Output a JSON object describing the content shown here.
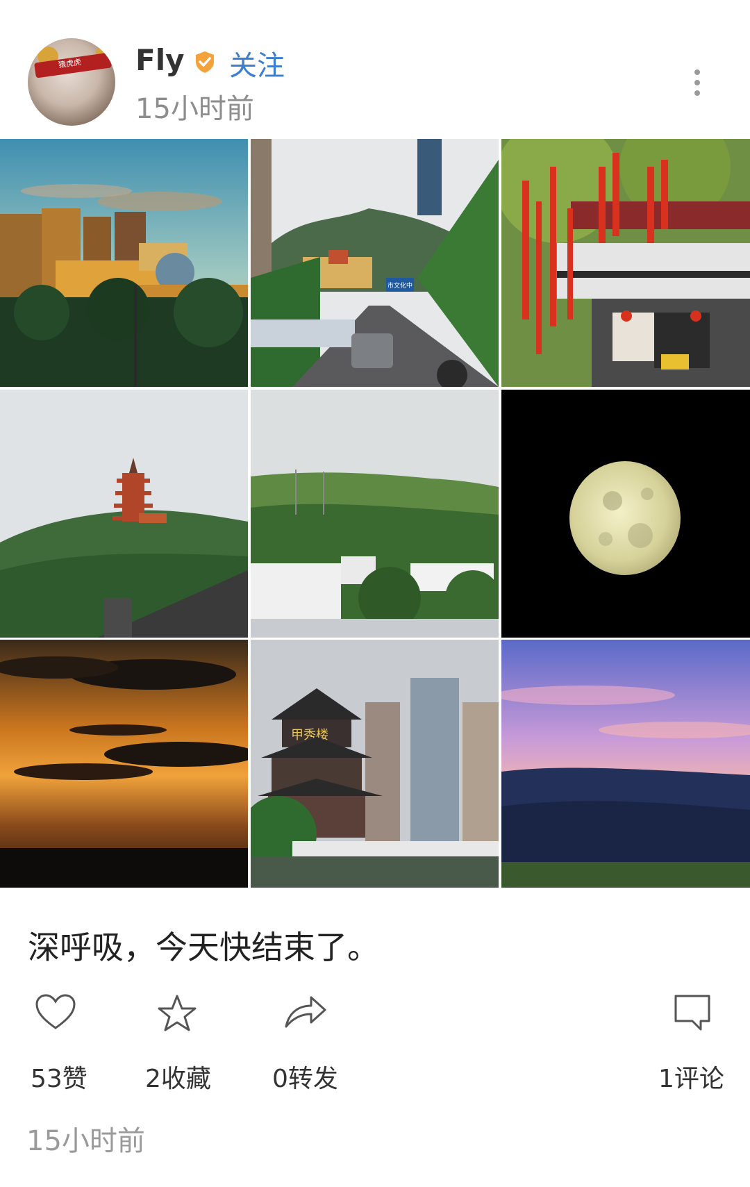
{
  "post": {
    "author": "Fly",
    "follow_label": "关注",
    "time_header": "15小时前",
    "caption": "深呼吸，今天快结束了。",
    "time_footer": "15小时前"
  },
  "avatar": {
    "badge_text": "猿虎虎"
  },
  "photos": [
    {
      "alt": "sunset-buildings",
      "sign_text": ""
    },
    {
      "alt": "city-road",
      "sign_text": "市文化中"
    },
    {
      "alt": "red-ribbon-temple",
      "sign_text": ""
    },
    {
      "alt": "pagoda-hill",
      "sign_text": ""
    },
    {
      "alt": "green-hills",
      "sign_text": ""
    },
    {
      "alt": "moon",
      "sign_text": ""
    },
    {
      "alt": "orange-sunset-clouds",
      "sign_text": ""
    },
    {
      "alt": "jiaxiu-tower",
      "sign_text": "甲秀楼"
    },
    {
      "alt": "pink-sky-mountains",
      "sign_text": ""
    }
  ],
  "actions": {
    "like": "53赞",
    "favorite": "2收藏",
    "repost": "0转发",
    "comment": "1评论"
  },
  "colors": {
    "follow_blue": "#3b7fd0",
    "verified_orange": "#f4a23c",
    "muted_text": "#8d8d8d"
  }
}
